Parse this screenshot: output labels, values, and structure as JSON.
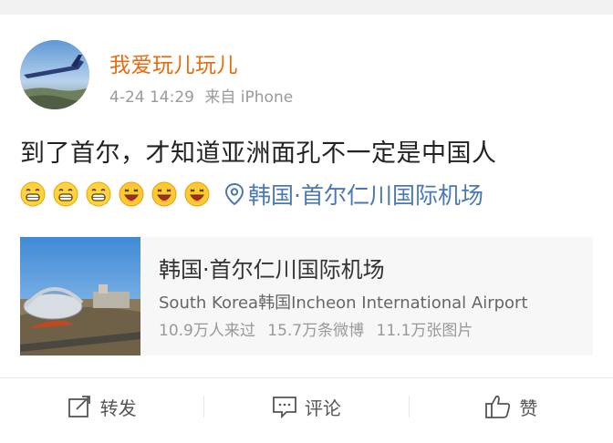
{
  "post": {
    "username": "我爱玩儿玩儿",
    "timestamp": "4-24 14:29",
    "source": "来自 iPhone",
    "text": "到了首尔，才知道亚洲面孔不一定是中国人",
    "emojis": [
      "grin-emoji",
      "grin-emoji",
      "grin-emoji",
      "laugh-emoji",
      "laugh-emoji",
      "laugh-emoji"
    ],
    "location_link": "韩国·首尔仁川国际机场"
  },
  "place_card": {
    "title": "韩国·首尔仁川国际机场",
    "subtitle": "South Korea韩国Incheon International Airport",
    "stats": {
      "visitors": "10.9万人来过",
      "posts": "15.7万条微博",
      "photos": "11.1万张图片"
    }
  },
  "actions": {
    "repost": "转发",
    "comment": "评论",
    "like": "赞"
  },
  "colors": {
    "username": "#e86b0c",
    "link": "#4a78b5",
    "background": "#f2f2f2"
  }
}
